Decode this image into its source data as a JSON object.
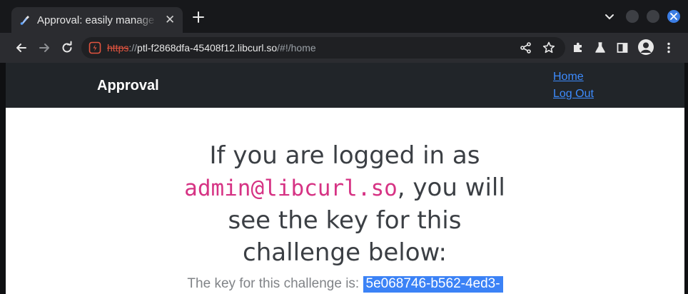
{
  "browser": {
    "tab": {
      "title": "Approval: easily manage your approvals",
      "close_glyph": "✕",
      "favicon": "paintbrush-icon"
    },
    "new_tab_glyph": "+",
    "address_bar": {
      "scheme": "https",
      "separator": "://",
      "host": "ptl-f2868dfa-45408f12.libcurl.so",
      "path": "/#!/home",
      "security_icon": "not-secure-icon"
    },
    "toolbar_icons": [
      "back-icon",
      "forward-icon",
      "reload-icon",
      "share-icon",
      "star-icon",
      "extensions-icon",
      "labs-icon",
      "side-panel-icon",
      "profile-icon",
      "menu-icon"
    ],
    "accent_color": "#3b7de4"
  },
  "app": {
    "brand": "Approval",
    "nav": {
      "home": "Home",
      "logout": "Log Out"
    },
    "headline": {
      "before": "If you are logged in as ",
      "email": "admin@libcurl.so",
      "after": ", you will see the key for this challenge below:"
    },
    "key": {
      "label": "The key for this challenge is: ",
      "value": "5e068746-b562-4ed3-"
    },
    "colors": {
      "navbar": "#212529",
      "link": "#3d8bfd",
      "email": "#d63384",
      "selection": "#3b82f6"
    }
  }
}
